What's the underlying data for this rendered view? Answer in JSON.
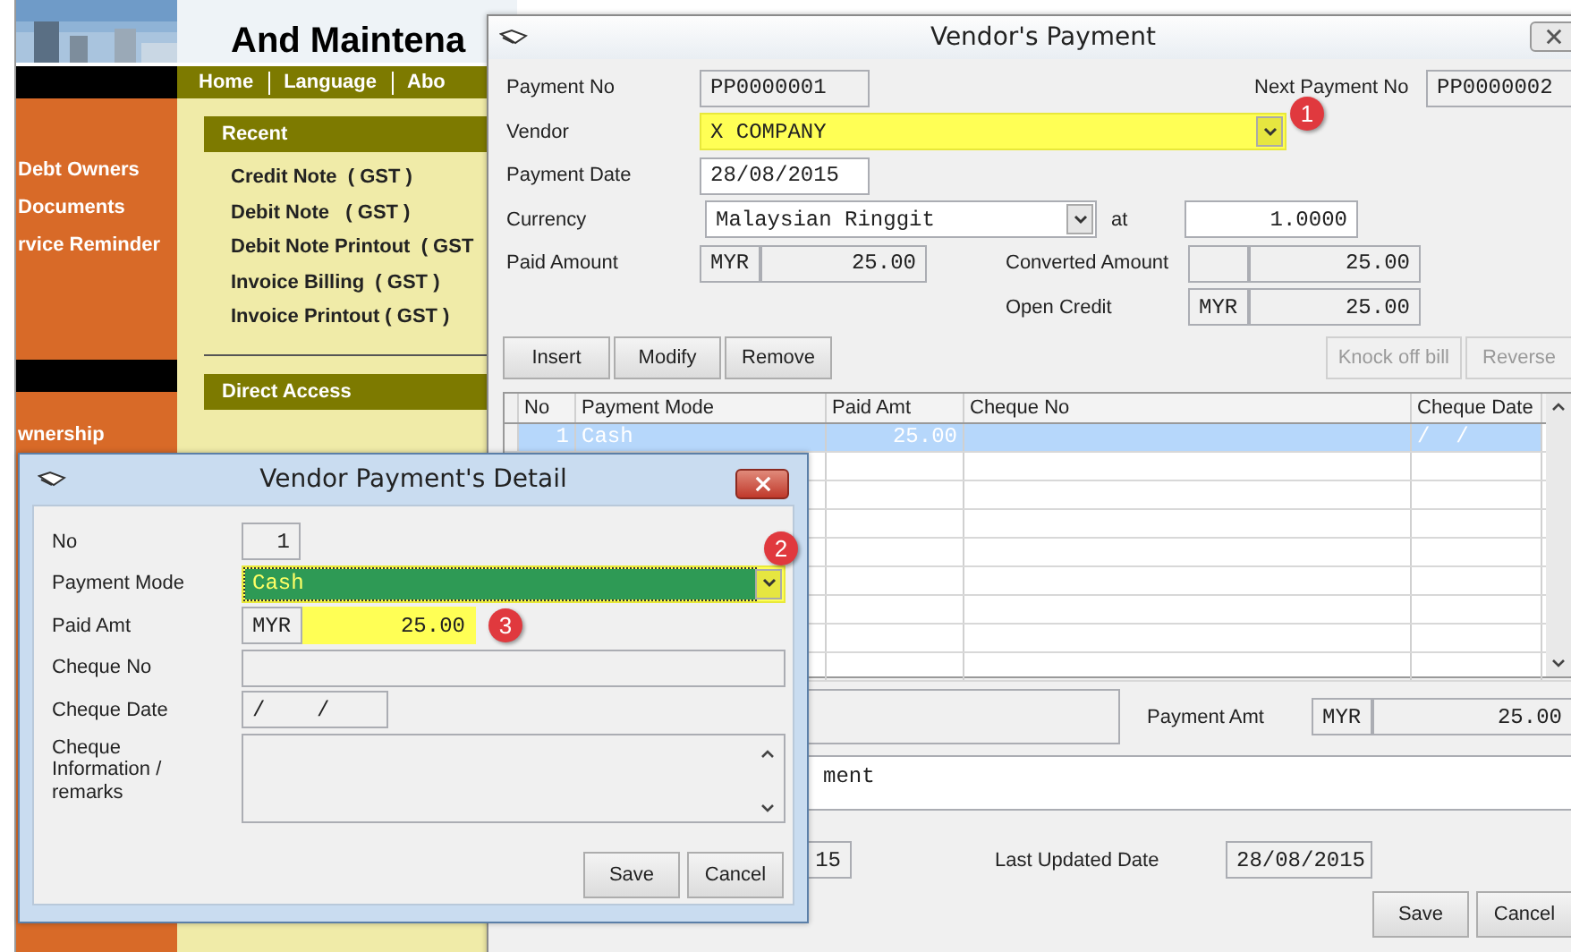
{
  "background_page": {
    "banner_title": "And Maintena",
    "nav": [
      "Home",
      "Language",
      "Abo"
    ],
    "sidebar_items": [
      "Debt Owners",
      "Documents",
      "rvice Reminder",
      "wnership"
    ],
    "recent": {
      "title": "Recent",
      "items": [
        "Credit Note  ( GST )",
        "Debit Note   ( GST )",
        "Debit Note Printout  ( GST",
        "Invoice Billing  ( GST )",
        "Invoice Printout ( GST )"
      ]
    },
    "direct_access": {
      "title": "Direct Access"
    }
  },
  "main_window": {
    "title": "Vendor's Payment",
    "payment_no": {
      "label": "Payment No",
      "value": "PP0000001"
    },
    "next_payment_no": {
      "label": "Next Payment No",
      "value": "PP0000002"
    },
    "vendor": {
      "label": "Vendor",
      "value": "X COMPANY",
      "highlighted": true,
      "badge": "1"
    },
    "payment_date": {
      "label": "Payment Date",
      "value": "28/08/2015"
    },
    "currency": {
      "label": "Currency",
      "value": "Malaysian Ringgit",
      "rate_label": "at",
      "rate": "1.0000"
    },
    "paid_amount": {
      "label": "Paid Amount",
      "currency": "MYR",
      "value": "25.00"
    },
    "converted_amount": {
      "label": "Converted Amount",
      "value": "25.00"
    },
    "open_credit": {
      "label": "Open Credit",
      "currency": "MYR",
      "value": "25.00"
    },
    "buttons": [
      {
        "label": "Insert",
        "disabled": false
      },
      {
        "label": "Modify",
        "disabled": false
      },
      {
        "label": "Remove",
        "disabled": false
      }
    ],
    "right_buttons": [
      {
        "label": "Knock off bill",
        "disabled": true
      },
      {
        "label": "Reverse",
        "disabled": true
      }
    ],
    "table": {
      "columns": [
        "No",
        "Payment Mode",
        "Paid Amt",
        "Cheque No",
        "Cheque Date"
      ],
      "rows": [
        {
          "no": "1",
          "payment_mode": "Cash",
          "paid_amt": "25.00",
          "cheque_date": "/  /",
          "selected": true
        }
      ]
    },
    "payment_amt": {
      "label": "Payment Amt",
      "currency": "MYR",
      "value": "25.00"
    },
    "remarks": "ment",
    "created_date_tail": "15",
    "last_updated": {
      "label": "Last Updated Date",
      "value": "28/08/2015"
    },
    "footer_buttons": [
      "Save",
      "Cancel"
    ]
  },
  "detail_dialog": {
    "title": "Vendor Payment's Detail",
    "no": {
      "label": "No",
      "value": "1"
    },
    "payment_mode": {
      "label": "Payment Mode",
      "value": "Cash",
      "highlighted": true,
      "focused": true,
      "badge": "2"
    },
    "paid_amt": {
      "label": "Paid Amt",
      "currency": "MYR",
      "value": "25.00",
      "highlighted": true,
      "badge": "3"
    },
    "cheque_no": {
      "label": "Cheque No"
    },
    "cheque_date": {
      "label": "Cheque Date",
      "value": "/    /"
    },
    "cheque_info": {
      "label": "Cheque Information / remarks"
    },
    "buttons": [
      "Save",
      "Cancel"
    ]
  }
}
